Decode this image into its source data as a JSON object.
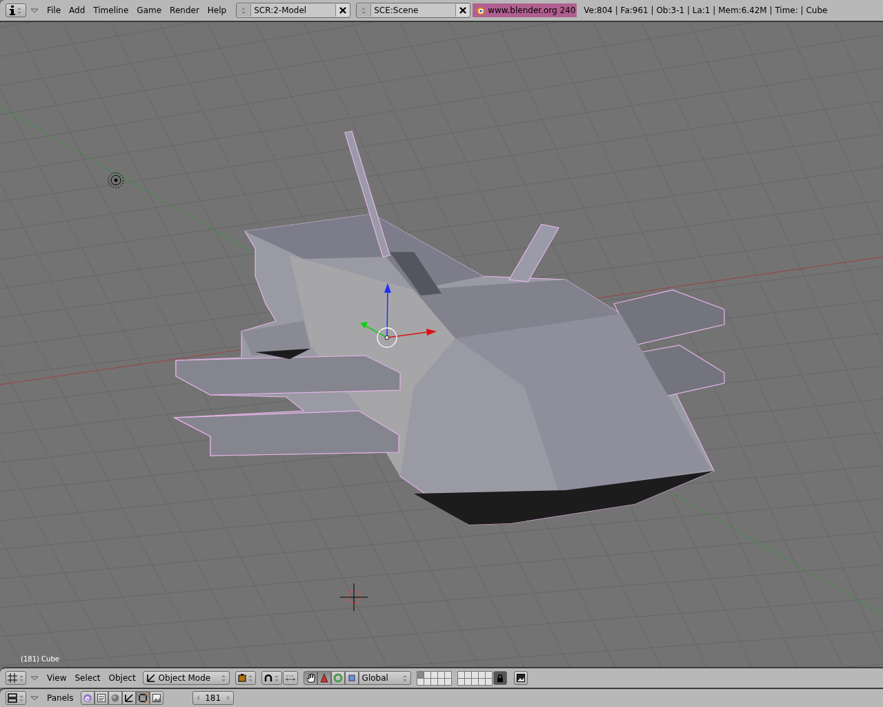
{
  "top_bar": {
    "menus": [
      "File",
      "Add",
      "Timeline",
      "Game",
      "Render",
      "Help"
    ],
    "screen": "SCR:2-Model",
    "scene": "SCE:Scene",
    "version": "www.blender.org 240",
    "stats": "Ve:804 | Fa:961 | Ob:3-1 | La:1 | Mem:6.42M | Time: | Cube"
  },
  "viewport": {
    "object_label": "(181) Cube"
  },
  "view3d_header": {
    "menus": [
      "View",
      "Select",
      "Object"
    ],
    "mode": "Object Mode",
    "manipulators": [
      {
        "kind": "hand",
        "selected": true
      },
      {
        "kind": "translate",
        "selected": true
      },
      {
        "kind": "rotate",
        "selected": false
      },
      {
        "kind": "scale",
        "selected": false
      }
    ],
    "orientation": "Global"
  },
  "buttons_header": {
    "menu": "Panels",
    "contexts": [
      {
        "kind": "logic",
        "selected": false
      },
      {
        "kind": "script",
        "selected": false
      },
      {
        "kind": "shading",
        "selected": false
      },
      {
        "kind": "object",
        "selected": false
      },
      {
        "kind": "editing",
        "selected": true
      },
      {
        "kind": "scene",
        "selected": false
      }
    ],
    "frame": "181"
  }
}
